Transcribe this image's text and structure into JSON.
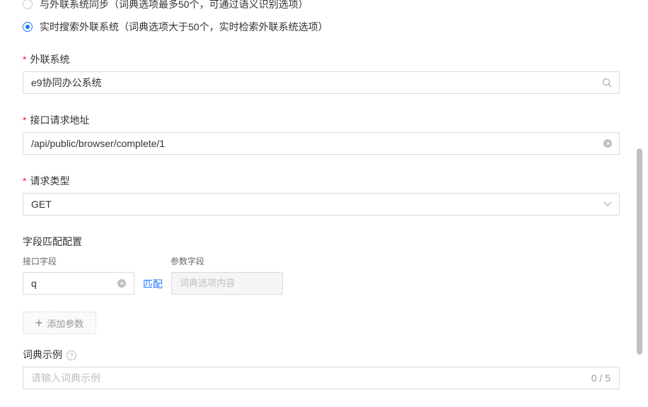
{
  "sync_options": [
    {
      "label": "与外联系统同步（词典选项最多50个，可通过语义识别选项）",
      "checked": false
    },
    {
      "label": "实时搜索外联系统（词典选项大于50个，实时检索外联系统选项）",
      "checked": true
    }
  ],
  "external_system": {
    "label": "外联系统",
    "value": "e9协同办公系统",
    "icon": "search-icon"
  },
  "api_url": {
    "label": "接口请求地址",
    "value": "/api/public/browser/complete/1",
    "icon": "clear-icon"
  },
  "request_type": {
    "label": "请求类型",
    "value": "GET",
    "icon": "chevron-down-icon"
  },
  "field_mapping": {
    "title": "字段匹配配置",
    "interface_field_label": "接口字段",
    "param_field_label": "参数字段",
    "interface_field_value": "q",
    "match_link": "匹配",
    "param_field_placeholder": "词典选项内容"
  },
  "add_param_button": "添加参数",
  "example": {
    "label": "词典示例",
    "placeholder": "请输入词典示例",
    "counter": "0 / 5"
  },
  "colors": {
    "accent": "#1677ff",
    "required": "#f5222d"
  }
}
